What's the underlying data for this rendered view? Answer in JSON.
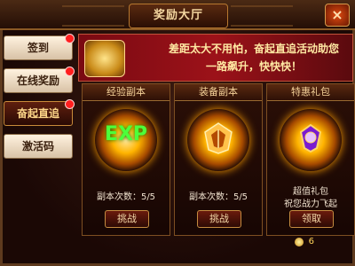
{
  "window": {
    "title": "奖励大厅",
    "close_label": "×"
  },
  "sidebar": {
    "items": [
      {
        "label": "签到",
        "active": false,
        "has_badge": true
      },
      {
        "label": "在线奖励",
        "active": false,
        "has_badge": true
      },
      {
        "label": "奋起直追",
        "active": true,
        "has_badge": true
      },
      {
        "label": "激活码",
        "active": false,
        "has_badge": false
      }
    ]
  },
  "banner": {
    "line1": "差距太大不用怕，奋起直追活动助您",
    "line2": "一路飙升，快快快！"
  },
  "cards": [
    {
      "header": "经验副本",
      "emblem": "EXP",
      "info_line1": "副本次数：5/5",
      "info_line2": "",
      "button": "挑战"
    },
    {
      "header": "装备副本",
      "emblem": "equipment-emblem",
      "info_line1": "副本次数：5/5",
      "info_line2": "",
      "button": "挑战"
    },
    {
      "header": "特惠礼包",
      "emblem": "gift-emblem",
      "info_line1": "超值礼包",
      "info_line2": "祝您战力飞起",
      "button": "领取"
    }
  ],
  "reward": {
    "gold": "6"
  },
  "colors": {
    "accent_gold": "#ffd88a",
    "badge_red": "#ff1e1e",
    "exp_green": "#4dff3a"
  }
}
